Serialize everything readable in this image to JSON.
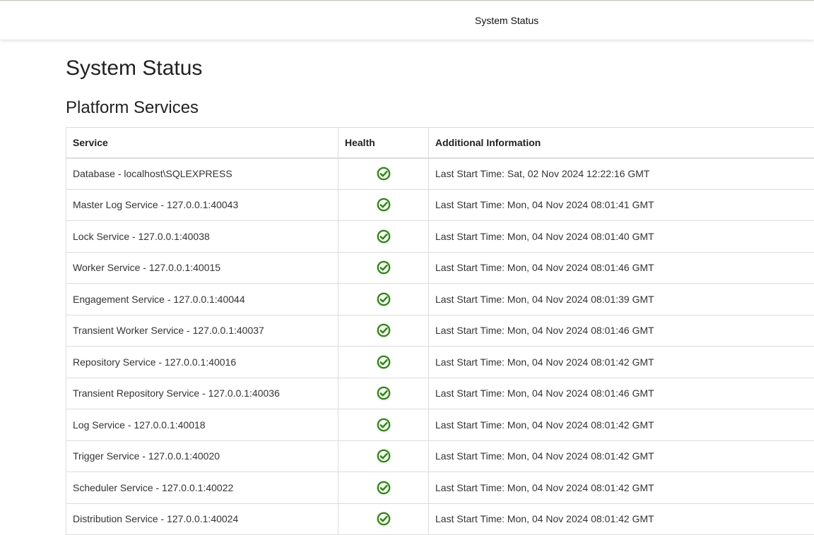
{
  "header": {
    "title": "System Status"
  },
  "page": {
    "title": "System Status",
    "section_title": "Platform Services"
  },
  "colors": {
    "healthy": "#2e8b12"
  },
  "table": {
    "columns": [
      "Service",
      "Health",
      "Additional Information"
    ],
    "rows": [
      {
        "service": "Database - localhost\\SQLEXPRESS",
        "health": "check-circle-icon",
        "info": "Last Start Time: Sat, 02 Nov 2024 12:22:16 GMT"
      },
      {
        "service": "Master Log Service - 127.0.0.1:40043",
        "health": "check-circle-icon",
        "info": "Last Start Time: Mon, 04 Nov 2024 08:01:41 GMT"
      },
      {
        "service": "Lock Service - 127.0.0.1:40038",
        "health": "check-circle-icon",
        "info": "Last Start Time: Mon, 04 Nov 2024 08:01:40 GMT"
      },
      {
        "service": "Worker Service - 127.0.0.1:40015",
        "health": "check-circle-icon",
        "info": "Last Start Time: Mon, 04 Nov 2024 08:01:46 GMT"
      },
      {
        "service": "Engagement Service - 127.0.0.1:40044",
        "health": "check-circle-icon",
        "info": "Last Start Time: Mon, 04 Nov 2024 08:01:39 GMT"
      },
      {
        "service": "Transient Worker Service - 127.0.0.1:40037",
        "health": "check-circle-icon",
        "info": "Last Start Time: Mon, 04 Nov 2024 08:01:46 GMT"
      },
      {
        "service": "Repository Service - 127.0.0.1:40016",
        "health": "check-circle-icon",
        "info": "Last Start Time: Mon, 04 Nov 2024 08:01:42 GMT"
      },
      {
        "service": "Transient Repository Service - 127.0.0.1:40036",
        "health": "check-circle-icon",
        "info": "Last Start Time: Mon, 04 Nov 2024 08:01:46 GMT"
      },
      {
        "service": "Log Service - 127.0.0.1:40018",
        "health": "check-circle-icon",
        "info": "Last Start Time: Mon, 04 Nov 2024 08:01:42 GMT"
      },
      {
        "service": "Trigger Service - 127.0.0.1:40020",
        "health": "check-circle-icon",
        "info": "Last Start Time: Mon, 04 Nov 2024 08:01:42 GMT"
      },
      {
        "service": "Scheduler Service - 127.0.0.1:40022",
        "health": "check-circle-icon",
        "info": "Last Start Time: Mon, 04 Nov 2024 08:01:42 GMT"
      },
      {
        "service": "Distribution Service - 127.0.0.1:40024",
        "health": "check-circle-icon",
        "info": "Last Start Time: Mon, 04 Nov 2024 08:01:42 GMT"
      }
    ]
  }
}
